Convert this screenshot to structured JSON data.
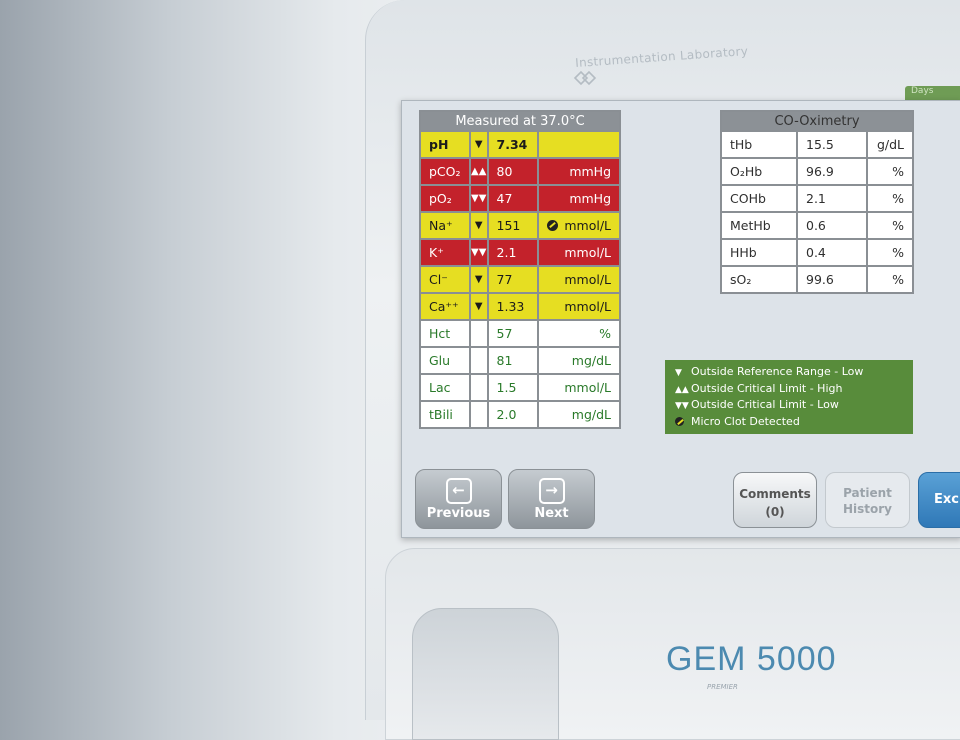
{
  "device": {
    "brand": "Instrumentation Laboratory",
    "model_logo": "GEM",
    "model_number": "5000",
    "model_sub": "PREMIER"
  },
  "screen_top_tab": "Days",
  "measured_table": {
    "header": "Measured at 37.0°C",
    "rows": [
      {
        "name": "pH",
        "flag": "▼",
        "value": "7.34",
        "unit": "",
        "status": "yellow"
      },
      {
        "name": "pCO₂",
        "flag": "▲▲",
        "value": "80",
        "unit": "mmHg",
        "status": "red"
      },
      {
        "name": "pO₂",
        "flag": "▼▼",
        "value": "47",
        "unit": "mmHg",
        "status": "red"
      },
      {
        "name": "Na⁺",
        "flag": "▼",
        "value": "151",
        "unit": "mmol/L",
        "status": "yellow",
        "clot": true
      },
      {
        "name": "K⁺",
        "flag": "▼▼",
        "value": "2.1",
        "unit": "mmol/L",
        "status": "red"
      },
      {
        "name": "Cl⁻",
        "flag": "▼",
        "value": "77",
        "unit": "mmol/L",
        "status": "yellow"
      },
      {
        "name": "Ca⁺⁺",
        "flag": "▼",
        "value": "1.33",
        "unit": "mmol/L",
        "status": "yellow"
      },
      {
        "name": "Hct",
        "flag": "",
        "value": "57",
        "unit": "%",
        "status": "white"
      },
      {
        "name": "Glu",
        "flag": "",
        "value": "81",
        "unit": "mg/dL",
        "status": "white"
      },
      {
        "name": "Lac",
        "flag": "",
        "value": "1.5",
        "unit": "mmol/L",
        "status": "white"
      },
      {
        "name": "tBili",
        "flag": "",
        "value": "2.0",
        "unit": "mg/dL",
        "status": "white"
      }
    ]
  },
  "co_oximetry": {
    "header": "CO-Oximetry",
    "rows": [
      {
        "name": "tHb",
        "value": "15.5",
        "unit": "g/dL"
      },
      {
        "name": "O₂Hb",
        "value": "96.9",
        "unit": "%"
      },
      {
        "name": "COHb",
        "value": "2.1",
        "unit": "%"
      },
      {
        "name": "MetHb",
        "value": "0.6",
        "unit": "%"
      },
      {
        "name": "HHb",
        "value": "0.4",
        "unit": "%"
      },
      {
        "name": "sO₂",
        "value": "99.6",
        "unit": "%"
      }
    ]
  },
  "legend": {
    "items": [
      {
        "symbol": "▼",
        "label": "Outside Reference Range - Low"
      },
      {
        "symbol": "▲▲",
        "label": "Outside Critical Limit - High"
      },
      {
        "symbol": "▼▼",
        "label": "Outside Critical Limit - Low"
      },
      {
        "symbol": "clot",
        "label": "Micro Clot Detected"
      }
    ]
  },
  "buttons": {
    "previous": "Previous",
    "next": "Next",
    "comments": "Comments",
    "comments_count": "(0)",
    "patient_history_line1": "Patient",
    "patient_history_line2": "History",
    "exclude": "Excl"
  },
  "colors": {
    "critical": "#c3222b",
    "reference": "#e6de22",
    "normal_text": "#2a7a2a",
    "legend_bg": "#588c3b",
    "accent_blue": "#2f78b7"
  }
}
